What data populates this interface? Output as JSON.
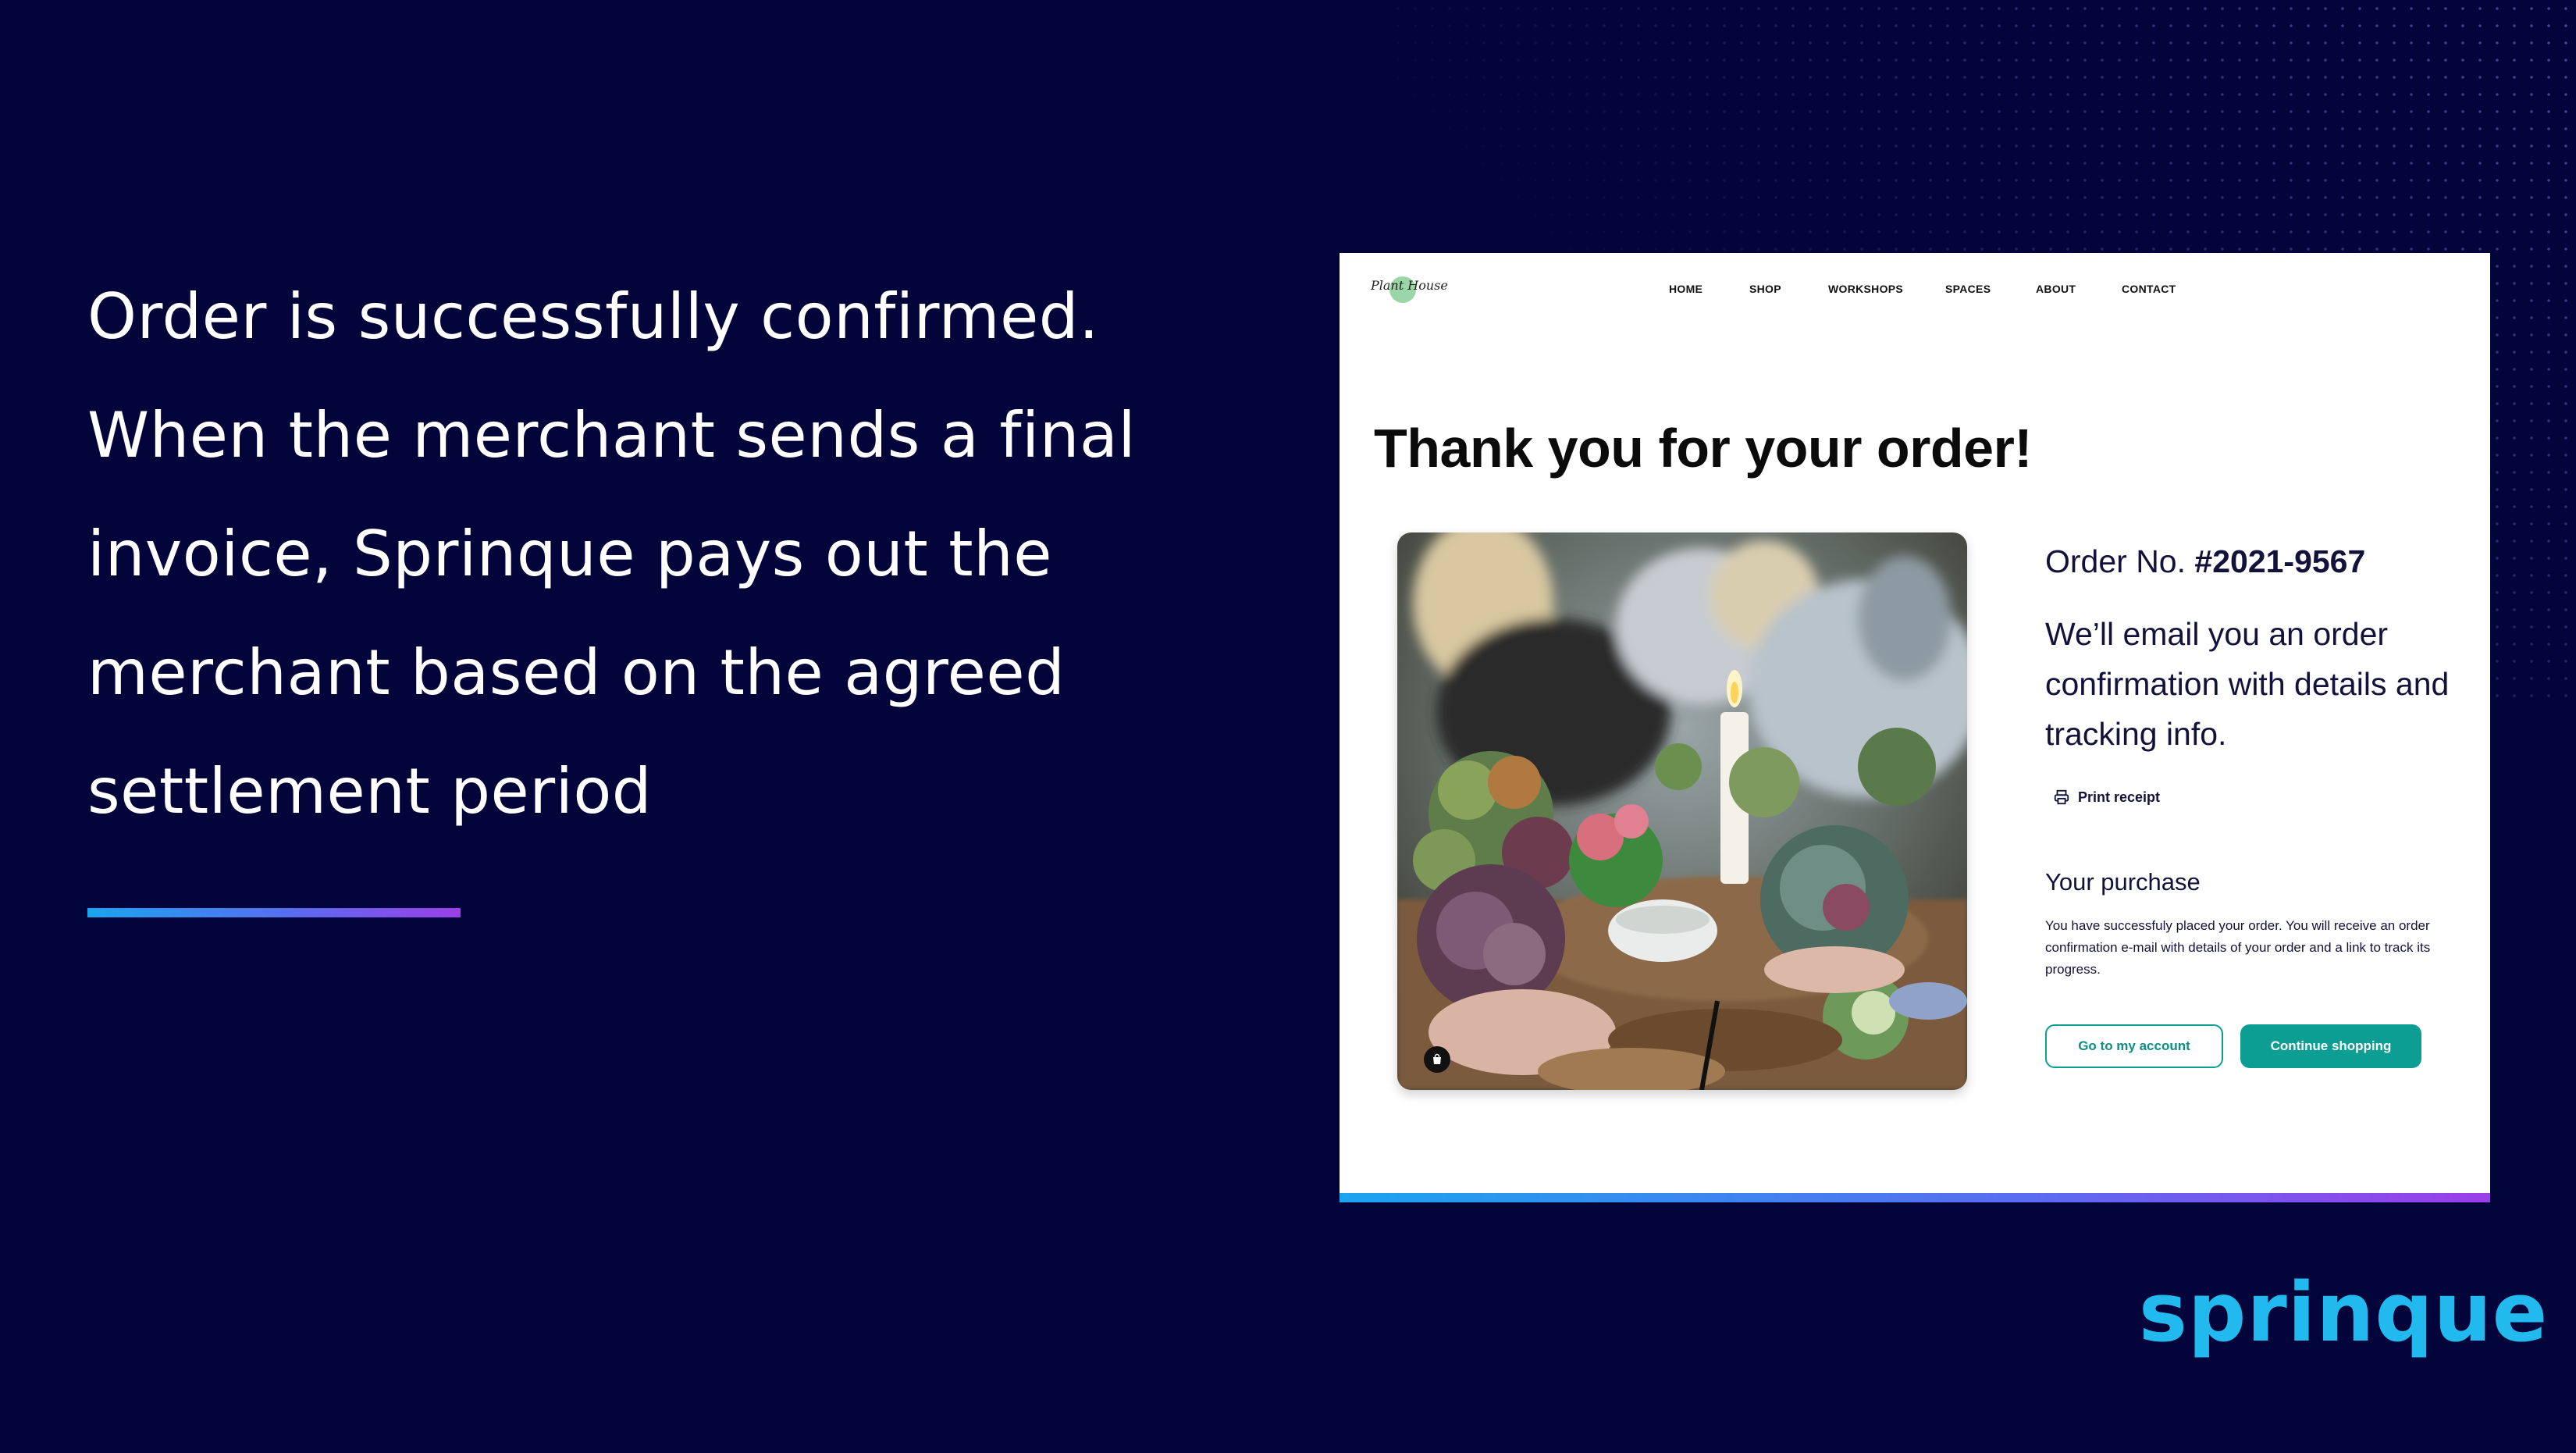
{
  "slide": {
    "headline_lines": [
      "Order is successfully confirmed.",
      "When the merchant sends a final",
      "invoice, Sprinque pays out the",
      "merchant based on the agreed",
      "settlement period"
    ],
    "brand": "sprinque",
    "colors": {
      "background": "#03043a",
      "accent_start": "#1aa4f0",
      "accent_end": "#9b3fe8",
      "brand": "#21b9ee"
    }
  },
  "shop": {
    "logo_text": "Plant House",
    "nav": [
      "HOME",
      "SHOP",
      "WORKSHOPS",
      "SPACES",
      "ABOUT",
      "CONTACT"
    ],
    "title": "Thank you for your order!",
    "order_label": "Order No.",
    "order_number": "#2021-9567",
    "email_message": "We’ll email you an order confirmation with details and tracking info.",
    "print_receipt": "Print receipt",
    "purchase_heading": "Your purchase",
    "purchase_text": "You have successfuly placed your order.  You will receive an order confirmation e-mail with details of your order and a link to track its progress.",
    "account_button": "Go to my account",
    "continue_button": "Continue shopping",
    "icons": [
      "printer-icon",
      "shopping-bag-icon"
    ],
    "accent_color": "#0d9e93"
  }
}
